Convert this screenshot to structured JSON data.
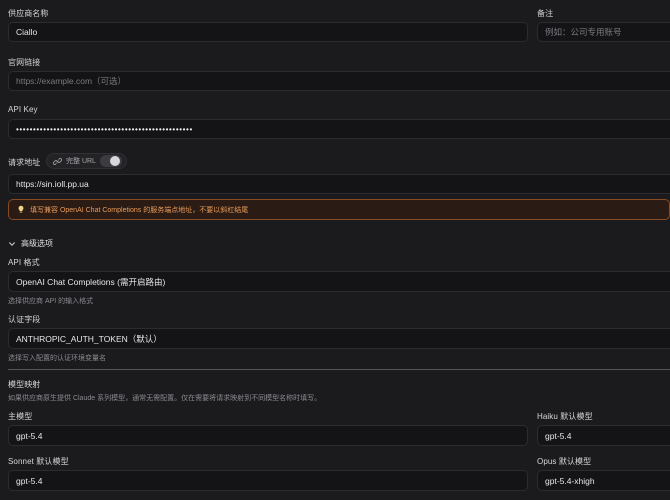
{
  "provider": {
    "name_label": "供应商名称",
    "name_value": "Ciallo",
    "note_label": "备注",
    "note_placeholder": "例如：公司专用账号"
  },
  "website": {
    "label": "官网链接",
    "placeholder": "https://example.com（可选）"
  },
  "api_key": {
    "label": "API Key",
    "masked_value": "••••••••••••••••••••••••••••••••••••••••••••••••••••"
  },
  "endpoint": {
    "label": "请求地址",
    "full_url_toggle_label": "完整 URL",
    "full_url_enabled": false,
    "value": "https://sin.ioll.pp.ua",
    "warning": "填写兼容 OpenAI Chat Completions 的服务端点地址，不要以斜杠结尾",
    "warning_color": "#e89a5a"
  },
  "advanced": {
    "title": "高级选项",
    "expanded": true,
    "api_format": {
      "label": "API 格式",
      "value": "OpenAI Chat Completions (需开启路由)",
      "hint": "选择供应商 API 的输入格式"
    },
    "auth_field": {
      "label": "认证字段",
      "value": "ANTHROPIC_AUTH_TOKEN（默认）",
      "hint": "选择写入配置的认证环境变量名"
    }
  },
  "model_mapping": {
    "title": "模型映射",
    "description": "如果供应商原生提供 Claude 系列模型，通常无需配置。仅在需要将请求映射到不同模型名称时填写。",
    "main_label": "主模型",
    "main_value": "gpt-5.4",
    "haiku_label": "Haiku 默认模型",
    "haiku_value": "gpt-5.4",
    "sonnet_label": "Sonnet 默认模型",
    "sonnet_value": "gpt-5.4",
    "opus_label": "Opus 默认模型",
    "opus_value": "gpt-5.4-xhigh"
  }
}
